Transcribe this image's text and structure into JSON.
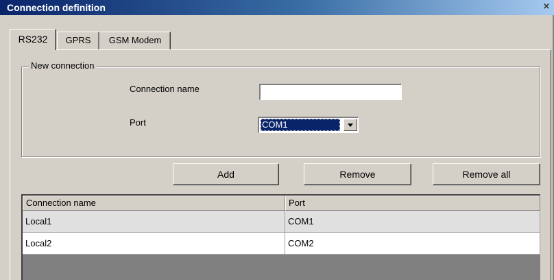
{
  "window": {
    "title": "Connection definition",
    "close_label": "×"
  },
  "tabs": [
    {
      "label": "RS232",
      "active": true
    },
    {
      "label": "GPRS",
      "active": false
    },
    {
      "label": "GSM Modem",
      "active": false
    }
  ],
  "group": {
    "legend": "New connection",
    "name_label": "Connection name",
    "name_value": "",
    "port_label": "Port",
    "port_value": "COM1"
  },
  "buttons": {
    "add": "Add",
    "remove": "Remove",
    "remove_all": "Remove all"
  },
  "table": {
    "columns": [
      "Connection name",
      "Port"
    ],
    "rows": [
      [
        "Local1",
        "COM1"
      ],
      [
        "Local2",
        "COM2"
      ]
    ],
    "selected_row": 0
  },
  "colors": {
    "face": "#d4d0c8",
    "title_start": "#0a246a",
    "title_end": "#a6caf0",
    "selection": "#0a246a",
    "row_selected": "#e0e0e0"
  }
}
